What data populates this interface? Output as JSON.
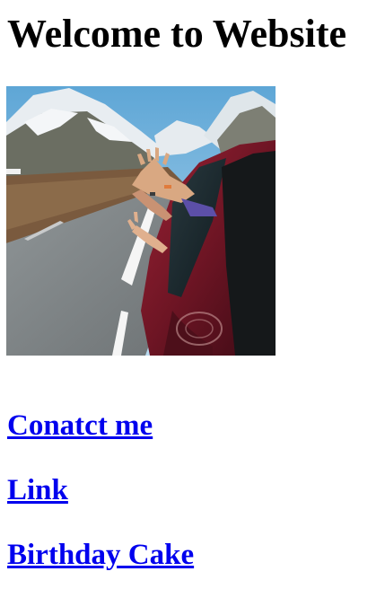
{
  "page": {
    "title": "Welcome to Website"
  },
  "hero_image": {
    "subject": "road-trip-car-hands-out-window-photo"
  },
  "links": [
    {
      "label": "Conatct me"
    },
    {
      "label": "Link"
    },
    {
      "label": "Birthday Cake"
    }
  ],
  "colors": {
    "link": "#0000ee",
    "heading": "#000000",
    "background": "#ffffff"
  }
}
